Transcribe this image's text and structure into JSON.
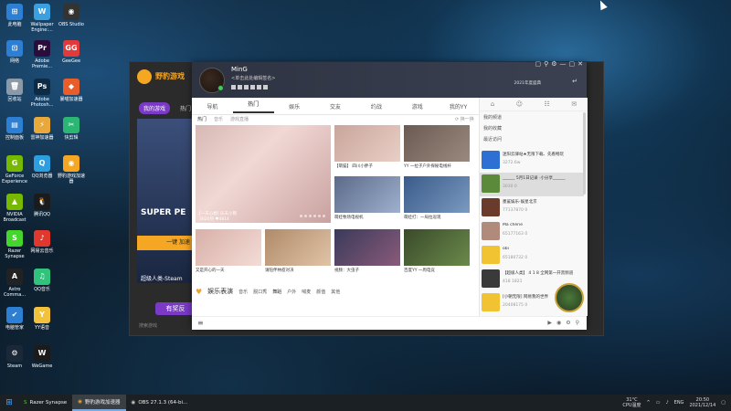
{
  "desktop": {
    "icons": [
      {
        "label": "此电脑",
        "color": "#2d7fd3",
        "glyph": "⊞"
      },
      {
        "label": "Wallpaper Engine:...",
        "color": "#3ba0e0",
        "glyph": "W"
      },
      {
        "label": "OBS Studio",
        "color": "#333333",
        "glyph": "◉"
      },
      {
        "label": "网络",
        "color": "#2d7fd3",
        "glyph": "⊡"
      },
      {
        "label": "Adobe Premie...",
        "color": "#2a0c3d",
        "glyph": "Pr"
      },
      {
        "label": "GeeGee",
        "color": "#e03a3a",
        "glyph": "GG"
      },
      {
        "label": "回收站",
        "color": "#8b9aa6",
        "glyph": "🗑"
      },
      {
        "label": "Adobe Photosh...",
        "color": "#0d2b45",
        "glyph": "Ps"
      },
      {
        "label": "暴喵加速器",
        "color": "#e85d2a",
        "glyph": "◆"
      },
      {
        "label": "控制面板",
        "color": "#2d7fd3",
        "glyph": "▤"
      },
      {
        "label": "雷神加速器",
        "color": "#e8a93a",
        "glyph": "⚡"
      },
      {
        "label": "快剪辑",
        "color": "#2bb673",
        "glyph": "✂"
      },
      {
        "label": "GeForce Experience",
        "color": "#76b900",
        "glyph": "G"
      },
      {
        "label": "QQ浏览器",
        "color": "#2d9ee0",
        "glyph": "Q"
      },
      {
        "label": "野豹游戏加速器",
        "color": "#f5a623",
        "glyph": "◉"
      },
      {
        "label": "NVIDIA Broadcast",
        "color": "#76b900",
        "glyph": "▲"
      },
      {
        "label": "腾讯QQ",
        "color": "#1b1b1b",
        "glyph": "🐧"
      },
      {
        "label": "Razer Synapse",
        "color": "#44d62c",
        "glyph": "S"
      },
      {
        "label": "网易云音乐",
        "color": "#e0382e",
        "glyph": "♪"
      },
      {
        "label": "Astro Comma...",
        "color": "#222222",
        "glyph": "A"
      },
      {
        "label": "QQ音乐",
        "color": "#31c27c",
        "glyph": "♫"
      },
      {
        "label": "电脑管家",
        "color": "#2d7fd3",
        "glyph": "✔"
      },
      {
        "label": "YY语音",
        "color": "#f3c23d",
        "glyph": "Y"
      },
      {
        "label": "Steam",
        "color": "#1b2838",
        "glyph": "⚙"
      },
      {
        "label": "WeGame",
        "color": "#1b1b1b",
        "glyph": "W"
      }
    ]
  },
  "background_app": {
    "logo_text": "野豹游戏",
    "logo_sub": "YeBao Game",
    "nav": [
      "我的游戏",
      "热门"
    ],
    "banner_title": "SUPER PE",
    "badge": "免费加速",
    "banner_label": "超级人类-Steam",
    "yellow_button": "一键 加速",
    "purple_button": "有奖反",
    "search": "搜索游戏"
  },
  "window": {
    "user": {
      "name": "MinG",
      "signature": "<单击此处编辑签名>"
    },
    "version": "2021年度盛典",
    "controls": [
      "▢",
      "⚲",
      "⚙",
      "—",
      "▢",
      "✕"
    ],
    "tabs": [
      "导航",
      "热门",
      "娱乐",
      "交友",
      "约战",
      "游戏",
      "我的YY"
    ],
    "active_tab": 1,
    "subtabs": [
      "热门",
      "音乐",
      "游戏直播"
    ],
    "refresh": "换一换",
    "big_card": {
      "label": "[一天心想] 乐天小熊",
      "stats": "3020热  ♥4814"
    },
    "cards": [
      {
        "caption": "【萌猫】 四川小胖子",
        "color1": "#c9a59b",
        "color2": "#e9cfc6"
      },
      {
        "caption": "YY 一拉子户外探秘电线杆",
        "color1": "#6a5a52",
        "color2": "#9a8a7e"
      },
      {
        "caption": "萌娃牧场电视机",
        "color1": "#5c6a8a",
        "color2": "#9db0cc"
      },
      {
        "caption": "萌娃打：一局拉逗现",
        "color1": "#3a5a8a",
        "color2": "#7a9ac0"
      },
      {
        "caption": "又是开心的一天",
        "color1": "#d8b0a8",
        "color2": "#f3dcd6"
      },
      {
        "caption": "请陪伴林疫对决",
        "color1": "#b08a6a",
        "color2": "#e0c4a6"
      },
      {
        "caption": "视频：大虫子",
        "color1": "#3a3a5a",
        "color2": "#8a5a7a"
      },
      {
        "caption": "百度YY 一周电竞",
        "color1": "#3a4a2a",
        "color2": "#6a8a4a"
      }
    ],
    "section": {
      "title": "娱乐表演",
      "tags": [
        "音乐",
        "脱口秀",
        "舞蹈",
        "户外",
        "喊麦",
        "颜值",
        "其他"
      ]
    }
  },
  "panel": {
    "links": [
      "我的频道",
      "我的收藏",
      "最近访问"
    ],
    "messages": [
      {
        "title": "迷阳云驿站★无限下载、先看畅玩",
        "sub": "3272.6w",
        "color": "#2d6fd3"
      },
      {
        "title": "______ 5月1日记录 ·小分享______",
        "sub": "3030  0",
        "color": "#5a8a3a"
      },
      {
        "title": "墨鲨娱乐-娱星北京",
        "sub": "77137870  0",
        "color": "#6a3a2a"
      },
      {
        "title": "Ma chérie",
        "sub": "65177163  0",
        "color": "#b08a7a"
      },
      {
        "title": "obi",
        "sub": "65180732  0",
        "color": "#f1c232"
      },
      {
        "title": "【超级人类】 4 1 8 全网第一开黑频道",
        "sub": "418  1821",
        "color": "#3a3a3a"
      },
      {
        "title": "[小朝无限] 网易我的世界",
        "sub": "20408175  0",
        "color": "#f1c232"
      }
    ]
  },
  "taskbar": {
    "tasks": [
      {
        "label": "Razer Synapse",
        "glyph": "S",
        "color": "#44d62c",
        "active": false
      },
      {
        "label": "野豹游戏加速器",
        "glyph": "◉",
        "color": "#f5a623",
        "active": true
      },
      {
        "label": "OBS 27.1.3 (64-bi...",
        "glyph": "◉",
        "color": "#cccccc",
        "active": false
      }
    ],
    "temp": "31°C",
    "temp_label": "CPU温度",
    "lang": "ENG",
    "time": "20:50",
    "date": "2021/12/14"
  }
}
